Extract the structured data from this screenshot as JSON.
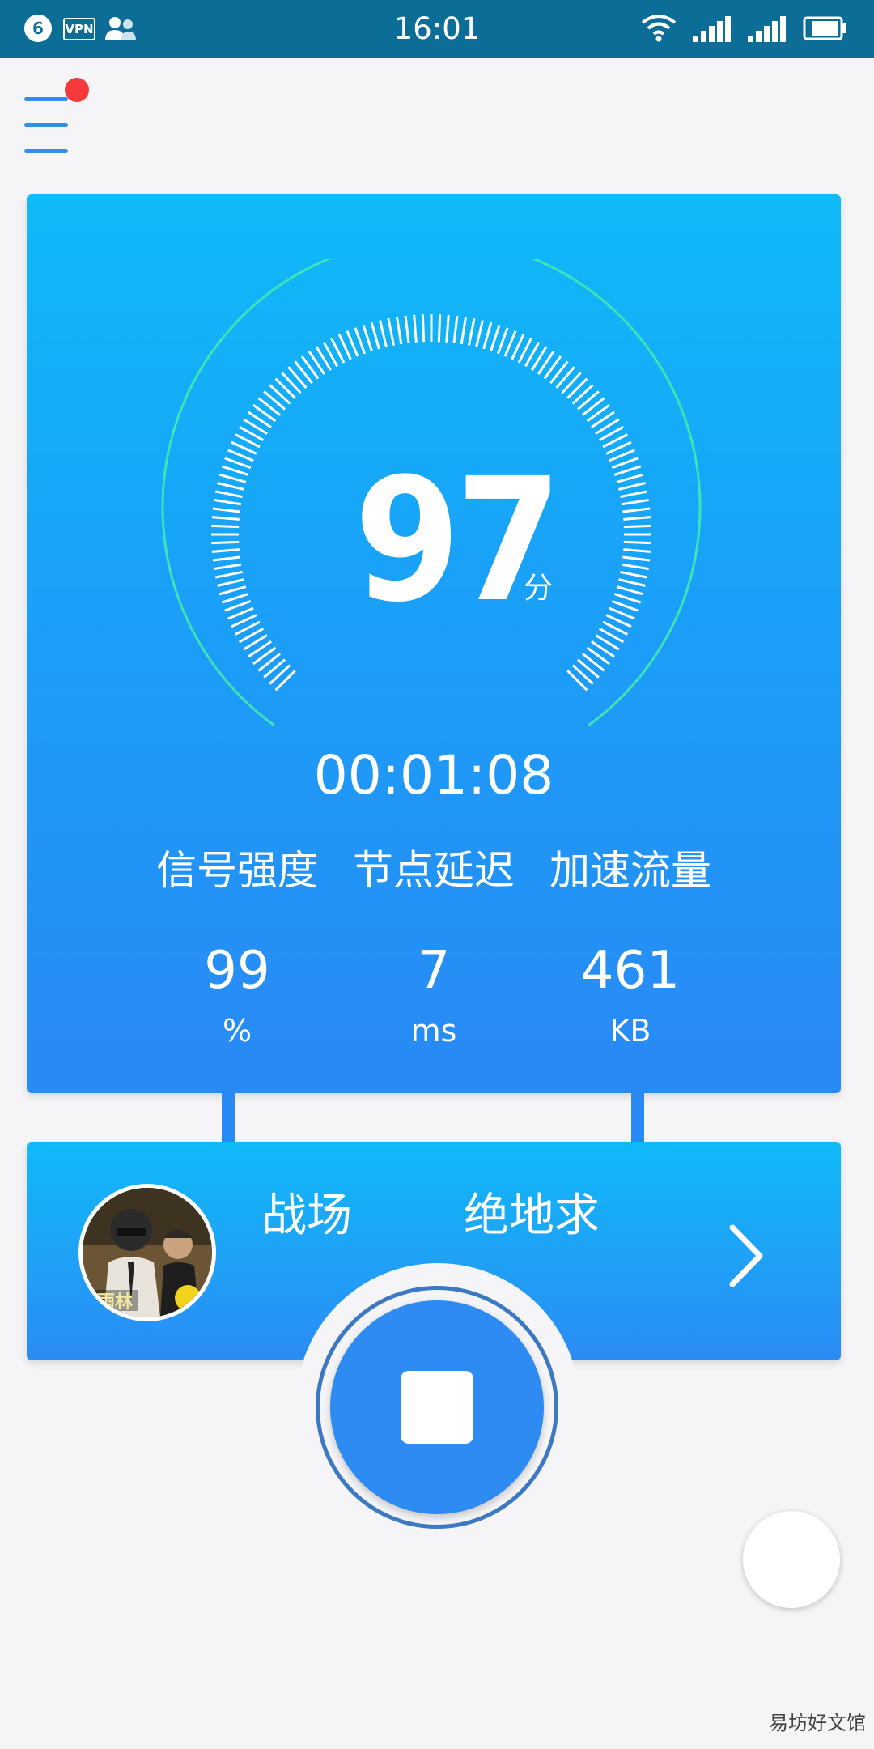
{
  "status_bar": {
    "notification_count": "6",
    "vpn_label": "VPN",
    "time": "16:01"
  },
  "speed_card": {
    "score": "97",
    "score_unit": "分",
    "timer": "00:01:08",
    "stats": [
      {
        "label": "信号强度",
        "value": "99",
        "unit": "%"
      },
      {
        "label": "节点延迟",
        "value": "7",
        "unit": "ms"
      },
      {
        "label": "加速流量",
        "value": "461",
        "unit": "KB"
      }
    ]
  },
  "game_card": {
    "marquee_text_1": "战场",
    "marquee_text_2": "绝地求",
    "avatar_caption": "雨林"
  },
  "watermark": "易坊好文馆",
  "colors": {
    "status_bar": "#0c6e97",
    "card_top": "#0fbaf8",
    "card_bottom": "#2989f5",
    "gauge_arc": "#3ee3b6",
    "notification_dot": "#f43a3a",
    "stop_button": "#2e8bf1"
  }
}
